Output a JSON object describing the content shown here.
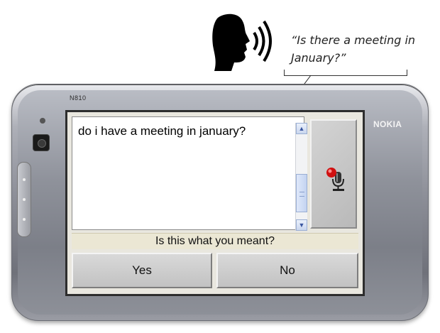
{
  "illustration": {
    "speaker_icon": "speaking-head-icon",
    "quote": "“Is there a meeting in January?”"
  },
  "device": {
    "model": "N810",
    "brand": "NOKIA",
    "body_color": "#8a8c95"
  },
  "screen": {
    "recognized_text": "do i have a meeting in january?",
    "mic_icon": "microphone-record-icon",
    "prompt": "Is this what you meant?",
    "buttons": {
      "yes_label": "Yes",
      "no_label": "No"
    },
    "colors": {
      "prompt_bg": "#ebe7d4",
      "button_bg": "#cfcfcf",
      "record_dot": "#d01010"
    }
  }
}
